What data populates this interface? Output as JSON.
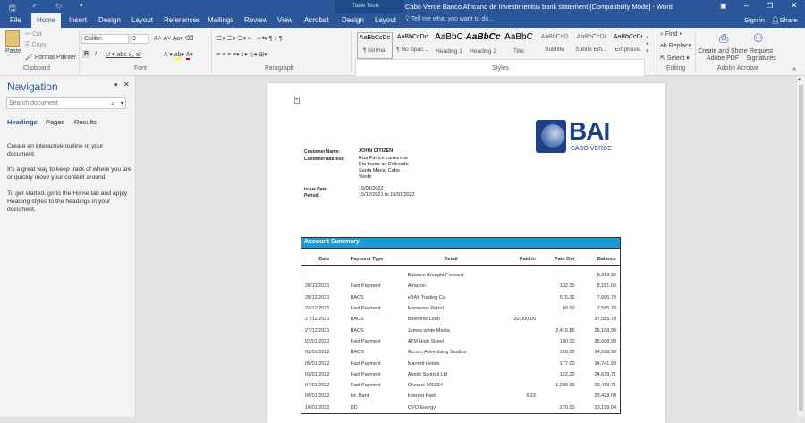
{
  "window": {
    "title": "Cabo Verde Banco Africano de Investimentos bank statement [Compatibility Mode] - Word",
    "table_tools": "Table Tools",
    "sign_in": "Sign in",
    "share": "Share"
  },
  "tabs": [
    "File",
    "Home",
    "Insert",
    "Design",
    "Layout",
    "References",
    "Mailings",
    "Review",
    "View",
    "Acrobat",
    "Design",
    "Layout"
  ],
  "tell_me": "Tell me what you want to do...",
  "ribbon": {
    "clipboard": {
      "paste": "Paste",
      "cut": "Cut",
      "copy": "Copy",
      "format_painter": "Format Painter",
      "label": "Clipboard"
    },
    "font": {
      "name": "Calibri",
      "size": "9",
      "label": "Font"
    },
    "paragraph": {
      "label": "Paragraph"
    },
    "styles": {
      "label": "Styles",
      "items": [
        {
          "preview": "AaBbCcDc",
          "name": "¶ Normal"
        },
        {
          "preview": "AaBbCcDc",
          "name": "¶ No Spac..."
        },
        {
          "preview": "AaBbC",
          "name": "Heading 1"
        },
        {
          "preview": "AaBbCc",
          "name": "Heading 2"
        },
        {
          "preview": "AaBbC",
          "name": "Title"
        },
        {
          "preview": "AaBbCcD",
          "name": "Subtitle"
        },
        {
          "preview": "AaBbCcDı",
          "name": "Subtle Em..."
        },
        {
          "preview": "AaBbCcDı",
          "name": "Emphasis"
        }
      ]
    },
    "editing": {
      "find": "Find",
      "replace": "Replace",
      "select": "Select",
      "label": "Editing"
    },
    "acrobat": {
      "create": "Create and Share Adobe PDF",
      "request": "Request Signatures",
      "label": "Adobe Acrobat"
    }
  },
  "navigation": {
    "title": "Navigation",
    "search_placeholder": "Search document",
    "tabs": [
      "Headings",
      "Pages",
      "Results"
    ],
    "p1": "Create an interactive outline of your document.",
    "p2": "It's a great way to keep track of where you are or quickly move your content around.",
    "p3": "To get started, go to the Home tab and apply Heading styles to the headings in your document."
  },
  "document": {
    "logo": {
      "text": "BAI",
      "sub": "CABO VERDE",
      "color": "#1d3f87"
    },
    "customer_name_label": "Customer Name:",
    "customer_name": "JOHN CITIZEN",
    "customer_address_label": "Customer address:",
    "address": [
      "Rua Patrice Lumumba",
      "Em frente ao Polivante,",
      "Santa Maria, Cabo",
      "Verde"
    ],
    "issue_date_label": "Issue Date:",
    "issue_date": "15/01/2022",
    "period_label": "Period:",
    "period": "15/12/2021 to 15/01/2022",
    "summary_title": "Account Summary",
    "accent": "#1a9ad6",
    "columns": [
      "Date",
      "Payment Type",
      "Detail",
      "Paid In",
      "Paid Out",
      "Balance"
    ],
    "rows": [
      [
        "",
        "",
        "Balance Brought Forward",
        "",
        "",
        "8,313.30"
      ],
      [
        "20/12/2021",
        "Fast Payment",
        "Amazon",
        "",
        "132.30",
        "8,181.00"
      ],
      [
        "20/12/2021",
        "BACS",
        "eBAY Trading Co.",
        "",
        "515.22",
        "7,665.78"
      ],
      [
        "23/12/2021",
        "Fast Payment",
        "Morrisons Petrol",
        "",
        "80.00",
        "7,585.78"
      ],
      [
        "27/12/2021",
        "BACS",
        "Business Loan",
        "20,000.00",
        "",
        "27,585.78"
      ],
      [
        "27/12/2021",
        "BACS",
        "Jumes white Media",
        "",
        "2,416.85",
        "25,168.93"
      ],
      [
        "02/01/2022",
        "Fast Payment",
        "ATM High Street",
        "",
        "100.00",
        "25,068.93"
      ],
      [
        "03/01/2022",
        "BACS",
        "Accorn Advertising Studios",
        "",
        "150.00",
        "24,918.93"
      ],
      [
        "05/01/2022",
        "Fast Payment",
        "Marriott Hotels",
        "",
        "177.00",
        "24,741.93"
      ],
      [
        "03/01/2022",
        "Fast Payment",
        "Abelio Scotrail Ltd",
        "",
        "122.22",
        "24,619.71"
      ],
      [
        "07/01/2022",
        "Fast Payment",
        "Cheque 000234",
        "",
        "1,200.00",
        "23,419.71"
      ],
      [
        "09/01/2022",
        "Int. Bank",
        "Interest Paid",
        "9.33",
        "",
        "23,429.04"
      ],
      [
        "10/01/2022",
        "DD",
        "OVO Energy",
        "",
        "270.00",
        "23,159.04"
      ]
    ]
  }
}
